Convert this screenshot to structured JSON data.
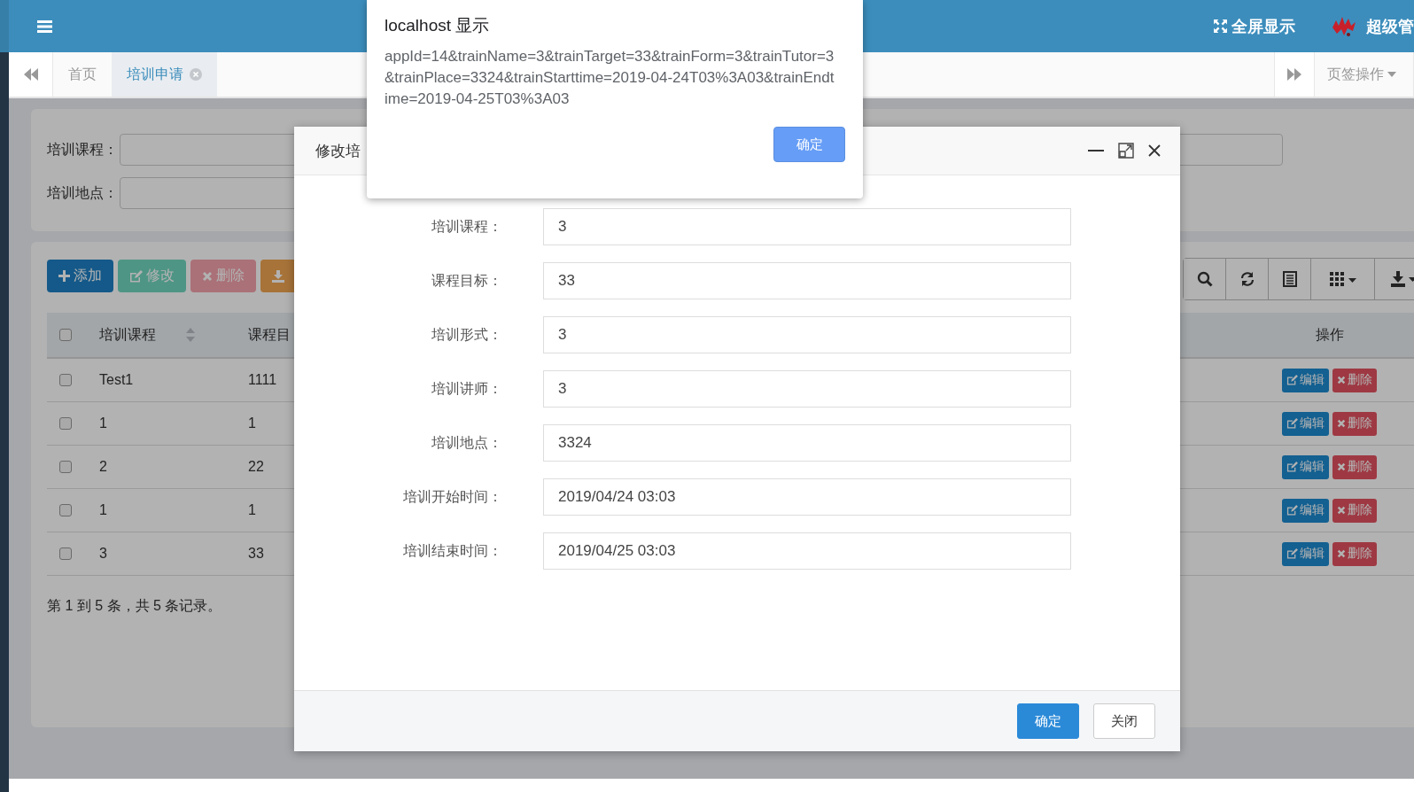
{
  "topbar": {
    "fullscreen": "全屏显示",
    "user": "超级管"
  },
  "tabs": {
    "items": [
      {
        "label": "首页",
        "selected": false,
        "closable": false
      },
      {
        "label": "培训申请",
        "selected": true,
        "closable": true
      }
    ],
    "menu": "页签操作"
  },
  "search": {
    "rows": [
      {
        "fields": [
          {
            "kind": "labeled",
            "label": "培训课程："
          },
          {
            "kind": "input"
          }
        ]
      },
      {
        "fields": [
          {
            "kind": "labeled",
            "label": "培训地点："
          }
        ]
      }
    ]
  },
  "toolbar": {
    "buttons": [
      {
        "kind": "add",
        "label": "添加"
      },
      {
        "kind": "edit",
        "label": "修改"
      },
      {
        "kind": "delete",
        "label": "删除"
      },
      {
        "kind": "export"
      }
    ],
    "tools": [
      {
        "kind": "search"
      },
      {
        "kind": "refresh"
      },
      {
        "kind": "list"
      },
      {
        "kind": "columns"
      },
      {
        "kind": "download"
      }
    ]
  },
  "table": {
    "all_checked": false,
    "columns": [
      "培训课程",
      "课程目"
    ],
    "action_column": "操作",
    "rows": [
      {
        "checked": false,
        "course": "Test1",
        "target": "1111",
        "actions": [
          "编辑",
          "删除"
        ]
      },
      {
        "checked": false,
        "course": "1",
        "target": "1",
        "actions": [
          "编辑",
          "删除"
        ]
      },
      {
        "checked": false,
        "course": "2",
        "target": "22",
        "actions": [
          "编辑",
          "删除"
        ]
      },
      {
        "checked": false,
        "course": "1",
        "target": "1",
        "actions": [
          "编辑",
          "删除"
        ]
      },
      {
        "checked": false,
        "course": "3",
        "target": "33",
        "actions": [
          "编辑",
          "删除"
        ]
      }
    ],
    "footer": "第 1 到 5 条，共 5 条记录。"
  },
  "dialog": {
    "title": "修改培",
    "fields": [
      {
        "label": "培训课程：",
        "value": "3"
      },
      {
        "label": "课程目标：",
        "value": "33"
      },
      {
        "label": "培训形式：",
        "value": "3"
      },
      {
        "label": "培训讲师：",
        "value": "3"
      },
      {
        "label": "培训地点：",
        "value": "3324"
      },
      {
        "label": "培训开始时间：",
        "value": "2019/04/24 03:03"
      },
      {
        "label": "培训结束时间：",
        "value": "2019/04/25 03:03"
      }
    ],
    "buttons": [
      {
        "kind": "primary",
        "label": "确定"
      },
      {
        "kind": "default",
        "label": "关闭"
      }
    ]
  },
  "alert": {
    "title": "localhost 显示",
    "message": "appId=14&trainName=3&trainTarget=33&trainForm=3&trainTutor=3&trainPlace=3324&trainStarttime=2019-04-24T03%3A03&trainEndtime=2019-04-25T03%3A03",
    "button": "确定"
  }
}
